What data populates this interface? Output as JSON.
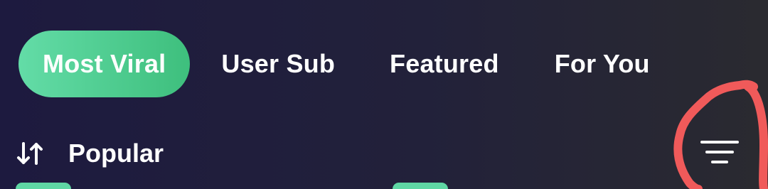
{
  "tabs": [
    {
      "label": "Most Viral",
      "active": true
    },
    {
      "label": "User Sub",
      "active": false
    },
    {
      "label": "Featured",
      "active": false
    },
    {
      "label": "For You",
      "active": false
    }
  ],
  "sort": {
    "icon": "sort-arrows-icon",
    "label": "Popular"
  },
  "filter": {
    "icon": "filter-icon"
  },
  "colors": {
    "background_start": "#1d1a3f",
    "background_end": "#2a2a30",
    "active_tab_start": "#63dca7",
    "active_tab_end": "#3ebf7d",
    "text": "#ffffff",
    "annotation": "#f05a5a"
  }
}
